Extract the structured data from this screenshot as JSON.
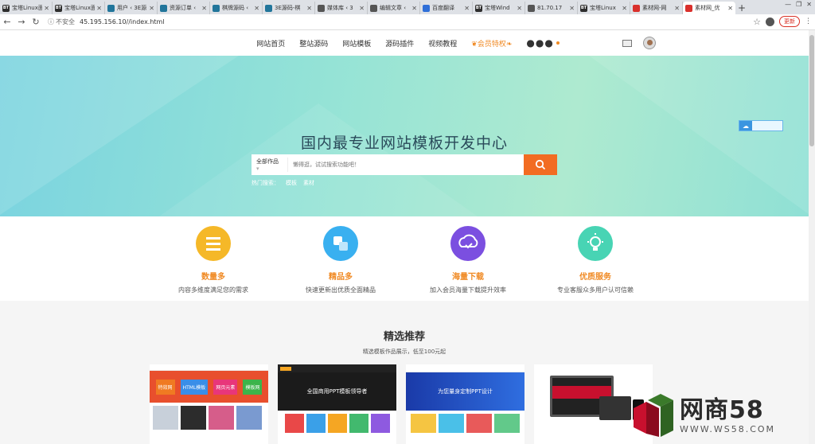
{
  "browser": {
    "tabs": [
      {
        "label": "宝塔Linux面",
        "favicon": "BT",
        "color": "#2e2e2e"
      },
      {
        "label": "宝塔Linux面",
        "favicon": "BT",
        "color": "#2e2e2e"
      },
      {
        "label": "用户 ‹ 3E源",
        "favicon": "wp-icon",
        "color": "#21759b"
      },
      {
        "label": "资源订单 ‹",
        "favicon": "wp-icon",
        "color": "#21759b"
      },
      {
        "label": "棋牌源码 ‹",
        "favicon": "wp-icon",
        "color": "#21759b"
      },
      {
        "label": "3E源码-棋",
        "favicon": "wp-icon",
        "color": "#21759b"
      },
      {
        "label": "媒体库 ‹ 3",
        "favicon": "globe-icon",
        "color": "#555555"
      },
      {
        "label": "编辑文章 ‹",
        "favicon": "globe-icon",
        "color": "#555555"
      },
      {
        "label": "百度翻译",
        "favicon": "translate-icon",
        "color": "#2f6fd8"
      },
      {
        "label": "宝塔Wind",
        "favicon": "BT",
        "color": "#2e2e2e"
      },
      {
        "label": "81.70.17",
        "favicon": "globe-icon",
        "color": "#555555"
      },
      {
        "label": "宝塔Linux",
        "favicon": "BT",
        "color": "#2e2e2e"
      },
      {
        "label": "素材网-网",
        "favicon": "sucai-icon",
        "color": "#d9302c"
      },
      {
        "label": "素材网_优",
        "favicon": "sucai-icon",
        "color": "#d9302c",
        "active": true
      }
    ],
    "insecure_label": "不安全",
    "url": "45.195.156.10//index.html",
    "update_label": "更新"
  },
  "nav": {
    "items": [
      "网站首页",
      "整站源码",
      "网站模板",
      "源码插件",
      "视频教程"
    ],
    "vip_label": "会员特权",
    "more_label": "●●●"
  },
  "hero": {
    "title": "国内最专业网站模板开发中心",
    "search_category": "全部作品",
    "search_placeholder": "懒得逛，试试搜索功能吧！",
    "hot_label": "热门搜索：",
    "hot_terms": [
      "模板",
      "素材"
    ]
  },
  "features": [
    {
      "title": "数量多",
      "desc": "内容多维度满足您的需求",
      "color": "#f5b828",
      "icon": "list-icon"
    },
    {
      "title": "精品多",
      "desc": "快速更新出优质全面精品",
      "color": "#39b0f0",
      "icon": "squares-icon"
    },
    {
      "title": "海量下载",
      "desc": "加入会员海量下载提升效率",
      "color": "#7b4fe0",
      "icon": "cloud-download-icon"
    },
    {
      "title": "优质服务",
      "desc": "专业客服众多用户认可信赖",
      "color": "#48d4b4",
      "icon": "bulb-icon"
    }
  ],
  "recommend": {
    "title": "精选推荐",
    "subtitle": "精选模板作品展示，低至100元起"
  },
  "cards": [
    {
      "thumb_title": "",
      "theme": "#ffffff"
    },
    {
      "thumb_title": "全国商用PPT模板领导者",
      "theme": "#1b1b1b"
    },
    {
      "thumb_title": "为您量身定制PPT设计",
      "theme": "#1e4bbf"
    },
    {
      "thumb_title": "",
      "theme": "#f4f4f4"
    }
  ],
  "card1_tiles": [
    "特效网",
    "HTML模板",
    "网页元素",
    "模板网"
  ],
  "watermark": {
    "brand": "网商58",
    "url": "WWW.WS58.COM"
  }
}
